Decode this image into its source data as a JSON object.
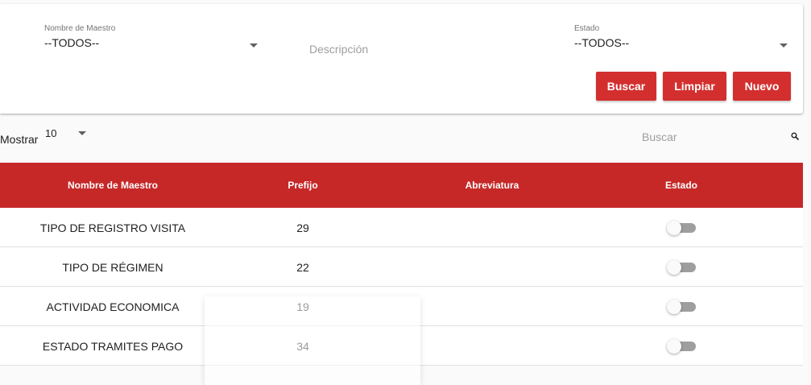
{
  "filters": {
    "maestro": {
      "label": "Nombre de Maestro",
      "value": "--TODOS--"
    },
    "descripcion": {
      "placeholder": "Descripción"
    },
    "estado": {
      "label": "Estado",
      "value": "--TODOS--"
    }
  },
  "actions": {
    "buscar": "Buscar",
    "limpiar": "Limpiar",
    "nuevo": "Nuevo"
  },
  "list_controls": {
    "mostrar_label": "Mostrar",
    "page_size": "10",
    "search_placeholder": "Buscar"
  },
  "table": {
    "headers": [
      "Nombre de Maestro",
      "Prefijo",
      "Abreviatura",
      "Estado"
    ],
    "rows": [
      {
        "nombre": "TIPO DE REGISTRO VISITA",
        "prefijo": "29",
        "abreviatura": "",
        "estado": false
      },
      {
        "nombre": "TIPO DE RÉGIMEN",
        "prefijo": "22",
        "abreviatura": "",
        "estado": false
      },
      {
        "nombre": "ACTIVIDAD ECONOMICA",
        "prefijo": "19",
        "abreviatura": "",
        "estado": false
      },
      {
        "nombre": "ESTADO TRAMITES PAGO",
        "prefijo": "34",
        "abreviatura": "",
        "estado": false
      }
    ]
  },
  "colors": {
    "accent": "#d32f2f",
    "header_bg": "#c62828",
    "toggle_off": "#9e9e9e"
  },
  "icons": {
    "dropdown": "caret-down-icon",
    "search": "search-icon"
  }
}
